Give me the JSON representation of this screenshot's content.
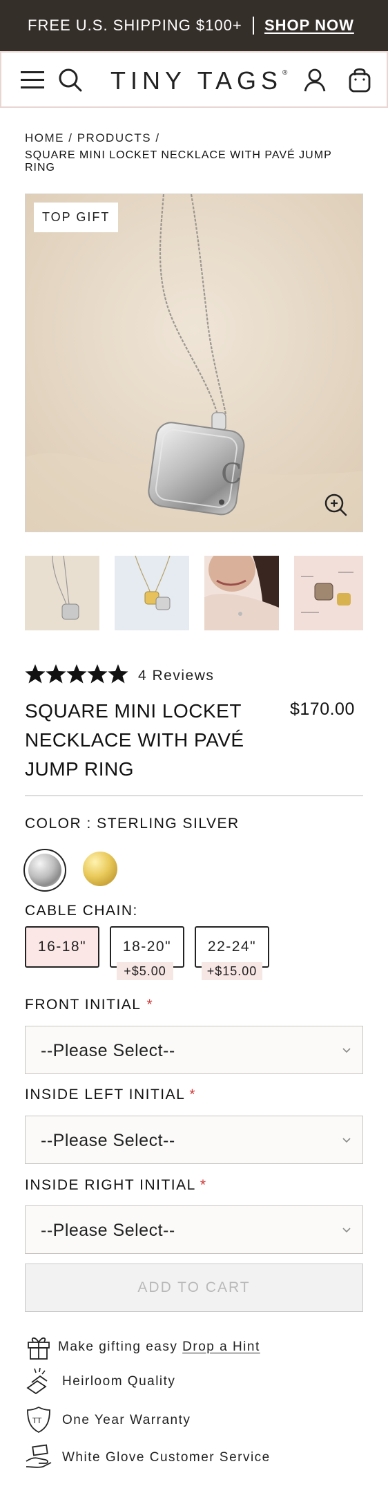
{
  "promo": {
    "shipping_text": "FREE U.S. SHIPPING $100+",
    "shop_now": "SHOP NOW"
  },
  "header": {
    "logo": "TINY TAGS",
    "logo_mark": "®",
    "icons": [
      "menu-icon",
      "search-icon",
      "account-icon",
      "bag-icon"
    ]
  },
  "breadcrumb": {
    "home": "HOME",
    "products": "PRODUCTS",
    "sep": "/",
    "current": "SQUARE MINI LOCKET NECKLACE WITH PAVÉ JUMP RING"
  },
  "gallery": {
    "badge": "TOP GIFT",
    "locket_initial": "C",
    "thumbnail_count": 4
  },
  "product": {
    "rating": 5,
    "reviews": "4 Reviews",
    "title": "SQUARE MINI LOCKET NECKLACE WITH PAVÉ JUMP RING",
    "price": "$170.00"
  },
  "options": {
    "color_label": "COLOR : STERLING SILVER",
    "colors": [
      {
        "name": "Sterling Silver",
        "hex": "#b5b5b5",
        "selected": true
      },
      {
        "name": "Gold",
        "hex": "#e2c050",
        "selected": false
      }
    ],
    "chain_label": "CABLE CHAIN:",
    "chains": [
      {
        "label": "16-18\"",
        "surcharge": "",
        "selected": true
      },
      {
        "label": "18-20\"",
        "surcharge": "+$5.00",
        "selected": false
      },
      {
        "label": "22-24\"",
        "surcharge": "+$15.00",
        "selected": false
      }
    ],
    "front_initial_label": "FRONT INITIAL",
    "inside_left_label": "INSIDE LEFT INITIAL",
    "inside_right_label": "INSIDE RIGHT INITIAL",
    "required_mark": "*",
    "select_placeholder": "--Please Select--"
  },
  "cart": {
    "add_to_cart": "ADD TO CART"
  },
  "perks": {
    "gift_text": "Make gifting easy",
    "gift_link": "Drop a Hint",
    "heirloom": "Heirloom Quality",
    "warranty": "One Year Warranty",
    "warranty_badge": "TT",
    "service": "White Glove Customer Service"
  },
  "colors": {
    "promo_bg": "#352f2a",
    "selected_chain_bg": "#fbe7e6",
    "required": "#d03a3a",
    "hero_bg": "#e8dccc"
  }
}
